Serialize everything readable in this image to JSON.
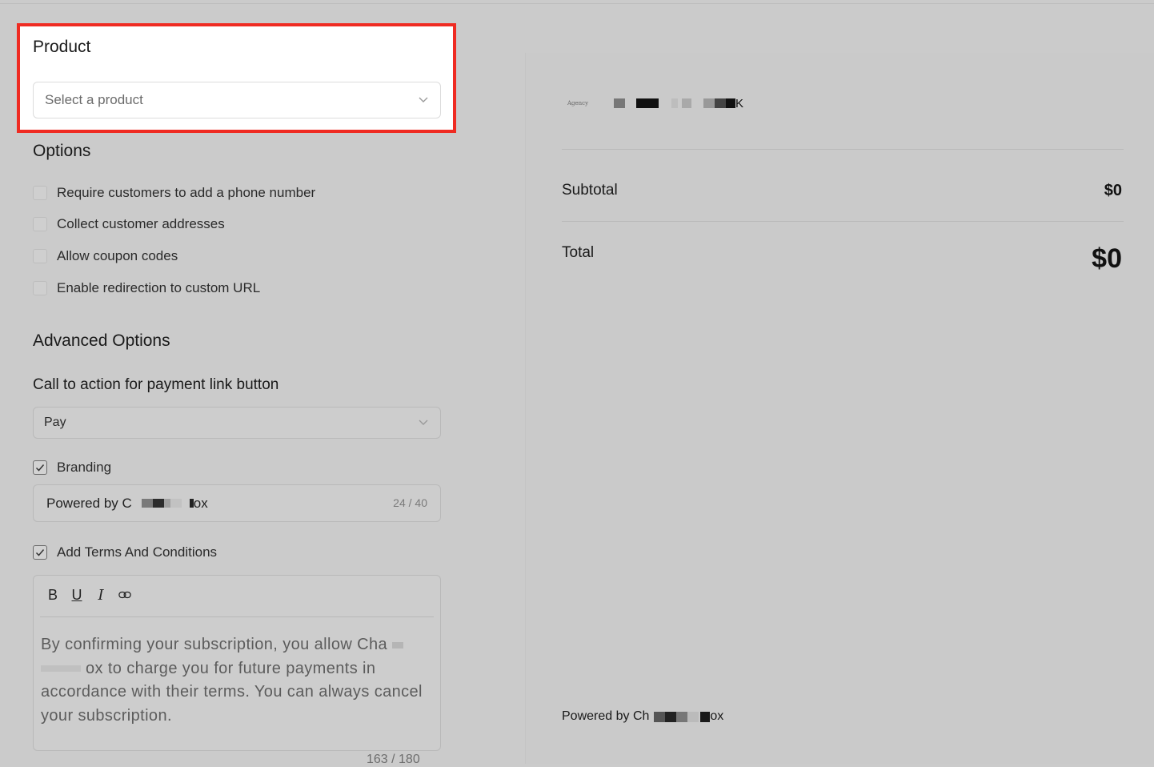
{
  "product": {
    "title": "Product",
    "placeholder": "Select a product"
  },
  "options": {
    "title": "Options",
    "items": [
      {
        "label": "Require customers to add a phone number",
        "checked": false
      },
      {
        "label": "Collect customer addresses",
        "checked": false
      },
      {
        "label": "Allow coupon codes",
        "checked": false
      },
      {
        "label": "Enable redirection to custom URL",
        "checked": false
      }
    ]
  },
  "advanced": {
    "title": "Advanced Options",
    "cta_label": "Call to action for payment link button",
    "cta_value": "Pay",
    "branding_label": "Branding",
    "branding_value_prefix": "Powered by C",
    "branding_value_suffix": "ox",
    "branding_count": "24 / 40",
    "terms_label": "Add Terms And Conditions",
    "terms_text_1": "By confirming your subscription, you allow Cha",
    "terms_text_2": "ox to charge you for future payments in accordance with their terms. You can always cancel your subscription.",
    "terms_count": "163 / 180",
    "toolbar": [
      "B",
      "U",
      "I",
      "link"
    ]
  },
  "preview": {
    "logo_text": "Agency",
    "logo_suffix": "K",
    "subtotal_label": "Subtotal",
    "subtotal_value": "$0",
    "total_label": "Total",
    "total_value": "$0",
    "powered_prefix": "Powered by Ch",
    "powered_suffix": "ox"
  },
  "colors": {
    "highlight_border": "#ef2b22",
    "background": "#cbcbcb"
  }
}
